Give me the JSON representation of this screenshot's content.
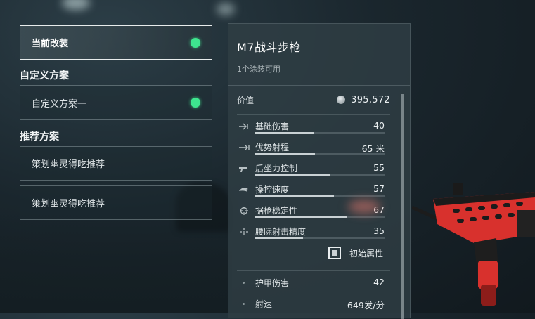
{
  "left": {
    "current_mod": "当前改装",
    "custom_section": "自定义方案",
    "custom_preset": "自定义方案一",
    "recommended_section": "推荐方案",
    "recommended": [
      "策划幽灵得吃推荐",
      "策划幽灵得吃推荐"
    ],
    "active_color": "#3ee58f"
  },
  "panel": {
    "weapon_name": "M7战斗步枪",
    "skins_available": "1个涂装可用",
    "value_label": "价值",
    "value_icon": "coin-icon",
    "value": "395,572",
    "stats": [
      {
        "label": "基础伤害",
        "value": "40",
        "icon": "damage-icon",
        "fill": 0.45
      },
      {
        "label": "优势射程",
        "value": "65 米",
        "icon": "range-icon",
        "fill": 0.46
      },
      {
        "label": "后坐力控制",
        "value": "55",
        "icon": "recoil-icon",
        "fill": 0.58
      },
      {
        "label": "操控速度",
        "value": "57",
        "icon": "handling-icon",
        "fill": 0.61
      },
      {
        "label": "据枪稳定性",
        "value": "67",
        "icon": "stability-icon",
        "fill": 0.71
      },
      {
        "label": "腰际射击精度",
        "value": "35",
        "icon": "hipfire-icon",
        "fill": 0.37
      }
    ],
    "base_attributes": "初始属性",
    "extra": [
      {
        "label": "护甲伤害",
        "value": "42"
      },
      {
        "label": "射速",
        "value": "649发/分"
      }
    ]
  },
  "colors": {
    "gun_accent": "#d8312d",
    "panel_bg": "#303e44"
  }
}
